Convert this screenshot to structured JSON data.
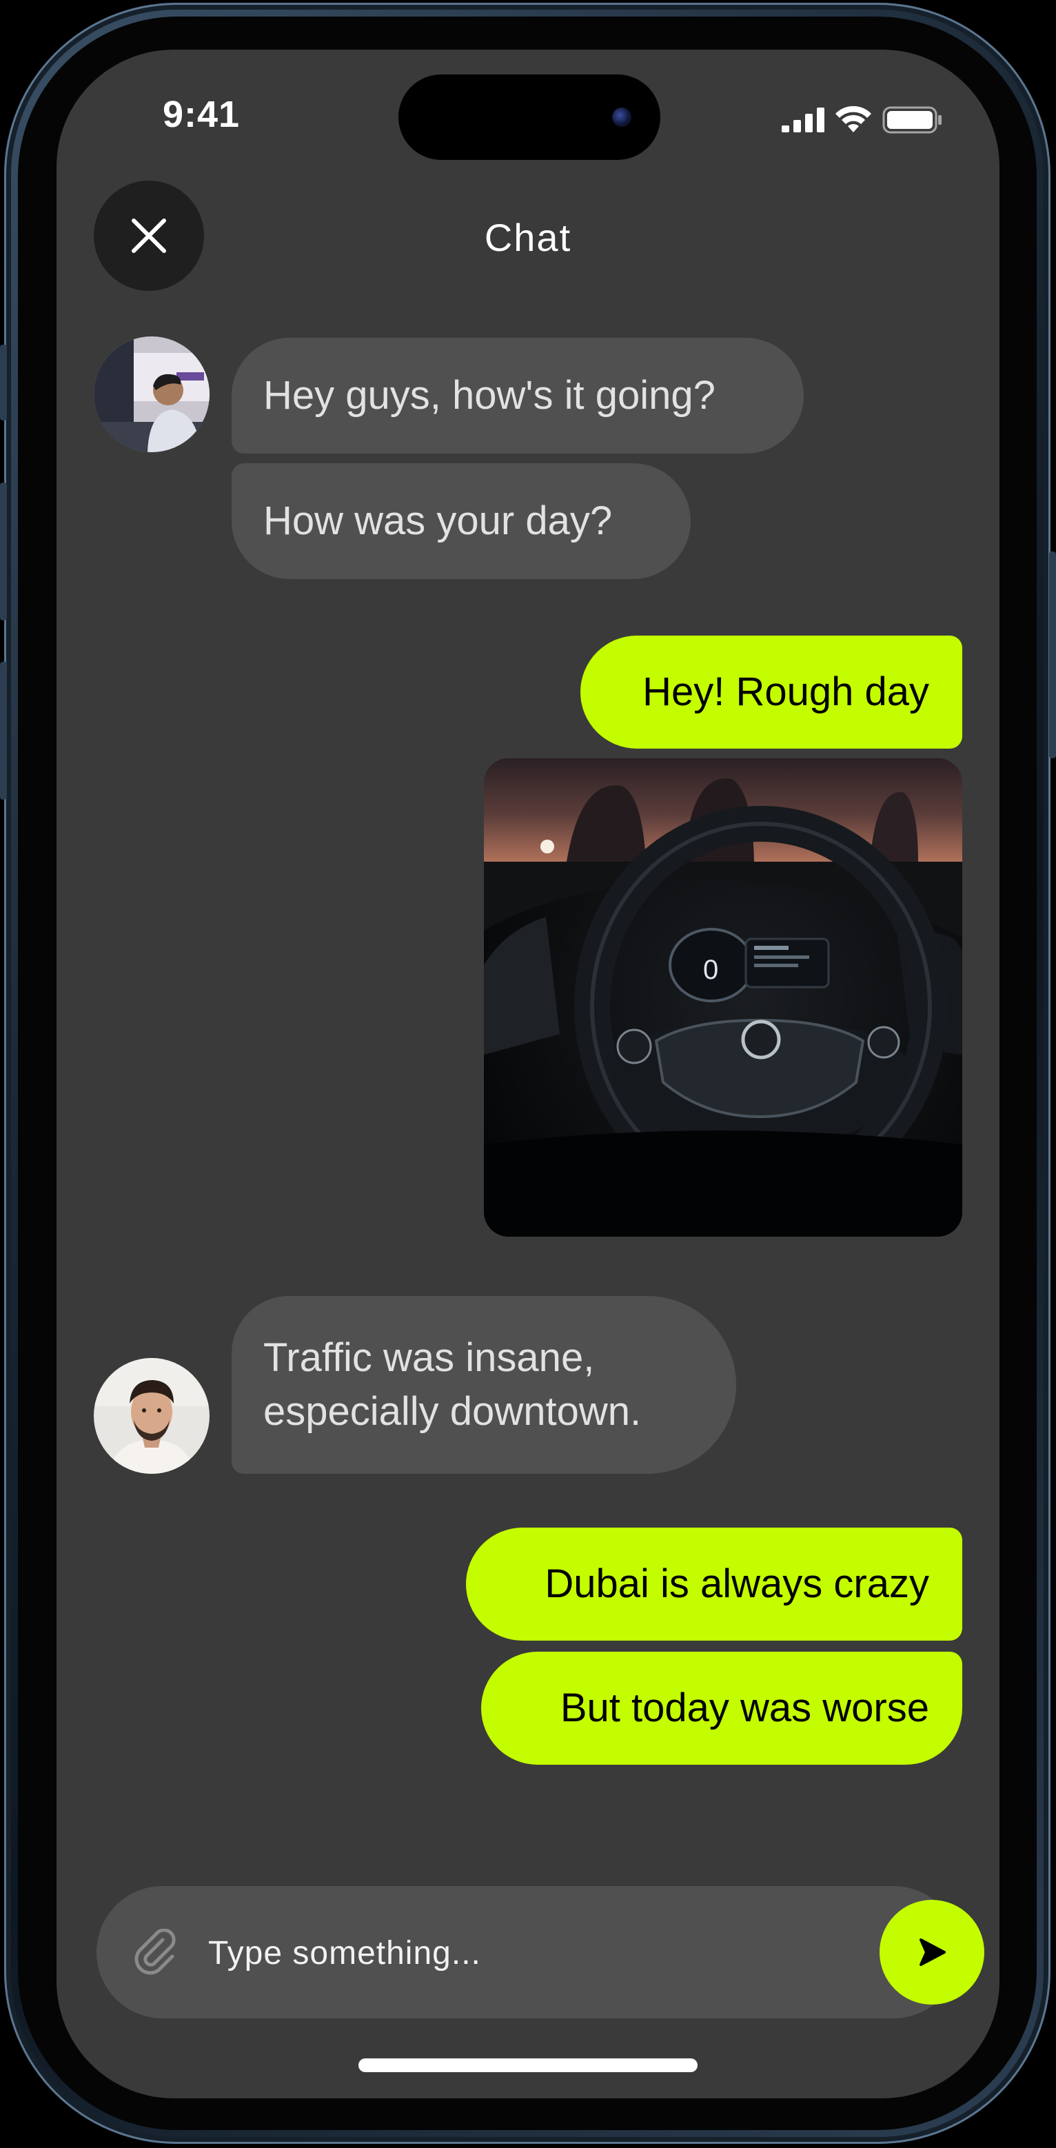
{
  "status_bar": {
    "time": "9:41",
    "icons": [
      "cellular-signal-icon",
      "wifi-icon",
      "battery-icon"
    ]
  },
  "header": {
    "title": "Chat",
    "close_icon": "close-icon"
  },
  "messages": [
    {
      "direction": "incoming",
      "sender_avatar": "avatar-man-in-car",
      "text": "Hey guys, how's it going?"
    },
    {
      "direction": "incoming",
      "text": "How was your day?"
    },
    {
      "direction": "outgoing",
      "text": "Hey! Rough day"
    },
    {
      "direction": "outgoing",
      "type": "image",
      "image_subject": "car-steering-wheel-photo"
    },
    {
      "direction": "incoming",
      "sender_avatar": "avatar-man-portrait",
      "text_lines": [
        "Traffic was insane,",
        "especially downtown."
      ]
    },
    {
      "direction": "outgoing",
      "text": "Dubai is always crazy"
    },
    {
      "direction": "outgoing",
      "text": "But today was worse"
    }
  ],
  "composer": {
    "placeholder": "Type something...",
    "value": "",
    "attach_icon": "paperclip-icon",
    "send_icon": "send-arrow-icon"
  },
  "colors": {
    "screen_background": "#3a3a3a",
    "incoming_bubble": "#505050",
    "outgoing_bubble": "#c4fd00",
    "close_button": "#1f1f1f"
  }
}
